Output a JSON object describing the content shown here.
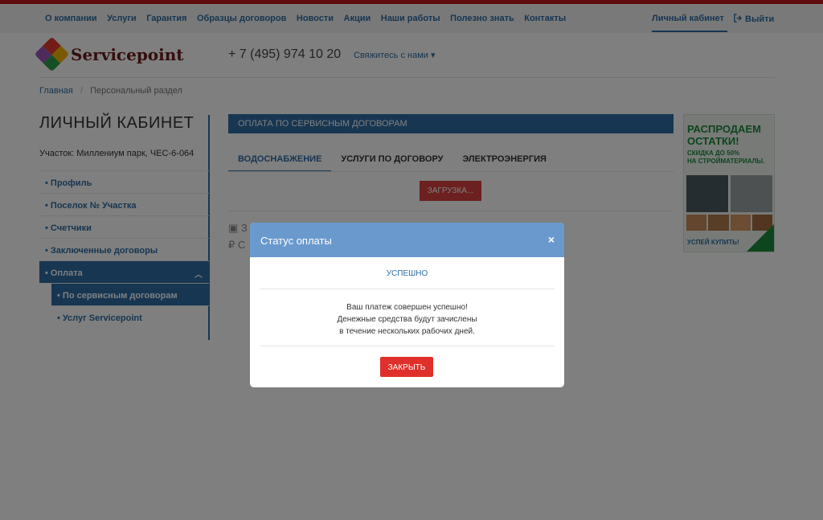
{
  "colors": {
    "brand_blue": "#2e6da4",
    "top_stripe": "#c3161c",
    "modal_header": "#6a99cd",
    "danger": "#e0302b",
    "banner_green": "#1a8a3c"
  },
  "topnav": {
    "items": [
      "О компании",
      "Услуги",
      "Гарантия",
      "Образцы договоров",
      "Новости",
      "Акции",
      "Наши работы",
      "Полезно знать",
      "Контакты"
    ],
    "cabinet": "Личный кабинет",
    "logout": "Выйти"
  },
  "header": {
    "logo_text": "Servicepoint",
    "phone": "+ 7 (495) 974 10 20",
    "contact_dropdown": "Свяжитесь с нами"
  },
  "breadcrumb": {
    "home": "Главная",
    "current": "Персональный раздел"
  },
  "sidebar": {
    "title": "ЛИЧНЫЙ КАБИНЕТ",
    "plot": "Участок: Миллениум парк, ЧЕС-6-064",
    "items": [
      "• Профиль",
      "• Поселок № Участка",
      "• Счетчики",
      "• Заключенные договоры",
      "• Оплата"
    ],
    "subitems": [
      "• По сервисным договорам",
      "• Услуг Servicepoint"
    ]
  },
  "main": {
    "section_title": "ОПЛАТА ПО СЕРВИСНЫМ ДОГОВОРАМ",
    "tabs": [
      "ВОДОСНАБЖЕНИЕ",
      "УСЛУГИ ПО ДОГОВОРУ",
      "ЭЛЕКТРОЭНЕРГИЯ"
    ],
    "active_tab": "ВОДОСНАБЖЕНИЕ",
    "loading": "ЗАГРУЗКА...",
    "icons": [
      "receipt-icon",
      "ruble-icon"
    ],
    "partial_labels": [
      "З",
      "С"
    ]
  },
  "banner": {
    "title_line1": "РАСПРОДАЕМ",
    "title_line2": "ОСТАТКИ!",
    "sub_line1": "СКИДКА ДО 50%",
    "sub_line2": "НА СТРОЙМАТЕРИАЛЫ.",
    "footer": "УСПЕЙ КУПИТЬ!"
  },
  "modal": {
    "title": "Статус оплаты",
    "close_icon": "×",
    "status": "УСПЕШНО",
    "message_line1": "Ваш платеж совершен успешно!",
    "message_line2": "Денежные средства будут зачислены",
    "message_line3": "в течение нескольких рабочих дней.",
    "close_button": "ЗАКРЫТЬ"
  }
}
